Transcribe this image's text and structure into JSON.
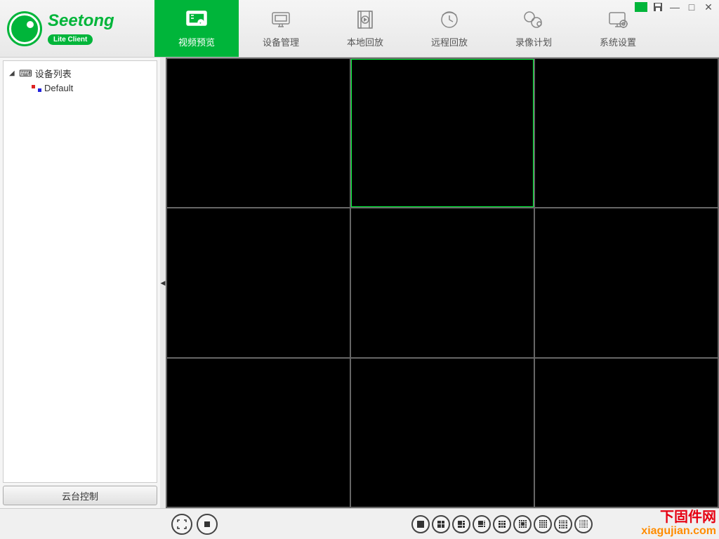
{
  "app": {
    "title": "Seetong",
    "subtitle": "Lite Client"
  },
  "nav": {
    "tabs": [
      {
        "label": "视频预览",
        "icon": "video-preview",
        "active": true
      },
      {
        "label": "设备管理",
        "icon": "device-manage",
        "active": false
      },
      {
        "label": "本地回放",
        "icon": "local-playback",
        "active": false
      },
      {
        "label": "远程回放",
        "icon": "remote-playback",
        "active": false
      },
      {
        "label": "录像计划",
        "icon": "record-plan",
        "active": false
      },
      {
        "label": "系统设置",
        "icon": "system-settings",
        "active": false
      }
    ]
  },
  "sidebar": {
    "root_label": "设备列表",
    "default_label": "Default",
    "ptz_button": "云台控制"
  },
  "grid": {
    "rows": 3,
    "cols": 3,
    "selected_index": 1
  },
  "watermark": {
    "line1": "下固件网",
    "line2": "xiagujian.com"
  }
}
